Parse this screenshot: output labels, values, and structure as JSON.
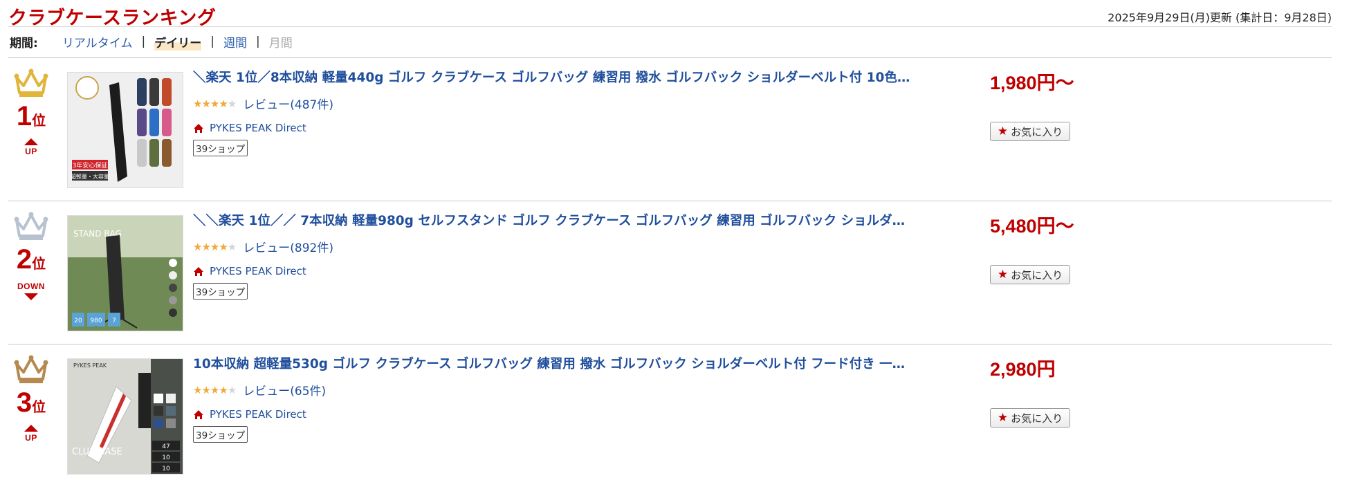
{
  "header": {
    "title": "クラブケースランキング",
    "updated": "2025年9月29日(月)更新 (集計日：9月28日)"
  },
  "periods": {
    "label": "期間:",
    "tabs": [
      {
        "label": "リアルタイム",
        "state": "link"
      },
      {
        "label": "デイリー",
        "state": "active"
      },
      {
        "label": "週間",
        "state": "link"
      },
      {
        "label": "月間",
        "state": "disabled"
      }
    ]
  },
  "colors": {
    "accent": "#bf0000",
    "link": "#1f4e9c",
    "gold": "#e0b53a",
    "silver": "#b8c2cf",
    "bronze": "#b5894f"
  },
  "items": [
    {
      "rank_num": "1",
      "rank_unit": "位",
      "crown": "gold-crown-icon",
      "trend": "UP",
      "name": "＼楽天 1位／8本収納 軽量440g ゴルフ クラブケース ゴルフバッグ 練習用 撥水 ゴルフバック ショルダーベルト付 10色…",
      "rating": 4,
      "review": "レビュー(487件)",
      "shop": "PYKES PEAK Direct",
      "badge": "39ショップ",
      "price": "1,980円〜",
      "fav_label": "お気に入り",
      "thumb_text": [
        "3年安心保証",
        "超軽量・大容量"
      ]
    },
    {
      "rank_num": "2",
      "rank_unit": "位",
      "crown": "silver-crown-icon",
      "trend": "DOWN",
      "name": "＼＼楽天 1位／／ 7本収納 軽量980g セルフスタンド ゴルフ クラブケース ゴルフバッグ 練習用 ゴルフバック ショルダ…",
      "rating": 4,
      "review": "レビュー(892件)",
      "shop": "PYKES PEAK Direct",
      "badge": "39ショップ",
      "price": "5,480円〜",
      "fav_label": "お気に入り",
      "thumb_text": [
        "STAND BAG",
        "20",
        "980",
        "7"
      ]
    },
    {
      "rank_num": "3",
      "rank_unit": "位",
      "crown": "bronze-crown-icon",
      "trend": "UP",
      "name": "10本収納 超軽量530g ゴルフ クラブケース ゴルフバッグ 練習用 撥水 ゴルフバック ショルダーベルト付 フード付き 一…",
      "rating": 4,
      "review": "レビュー(65件)",
      "shop": "PYKES PEAK Direct",
      "badge": "39ショップ",
      "price": "2,980円",
      "fav_label": "お気に入り",
      "thumb_text": [
        "PYKES PEAK",
        "CLUB CASE",
        "47",
        "10",
        "10"
      ]
    }
  ]
}
